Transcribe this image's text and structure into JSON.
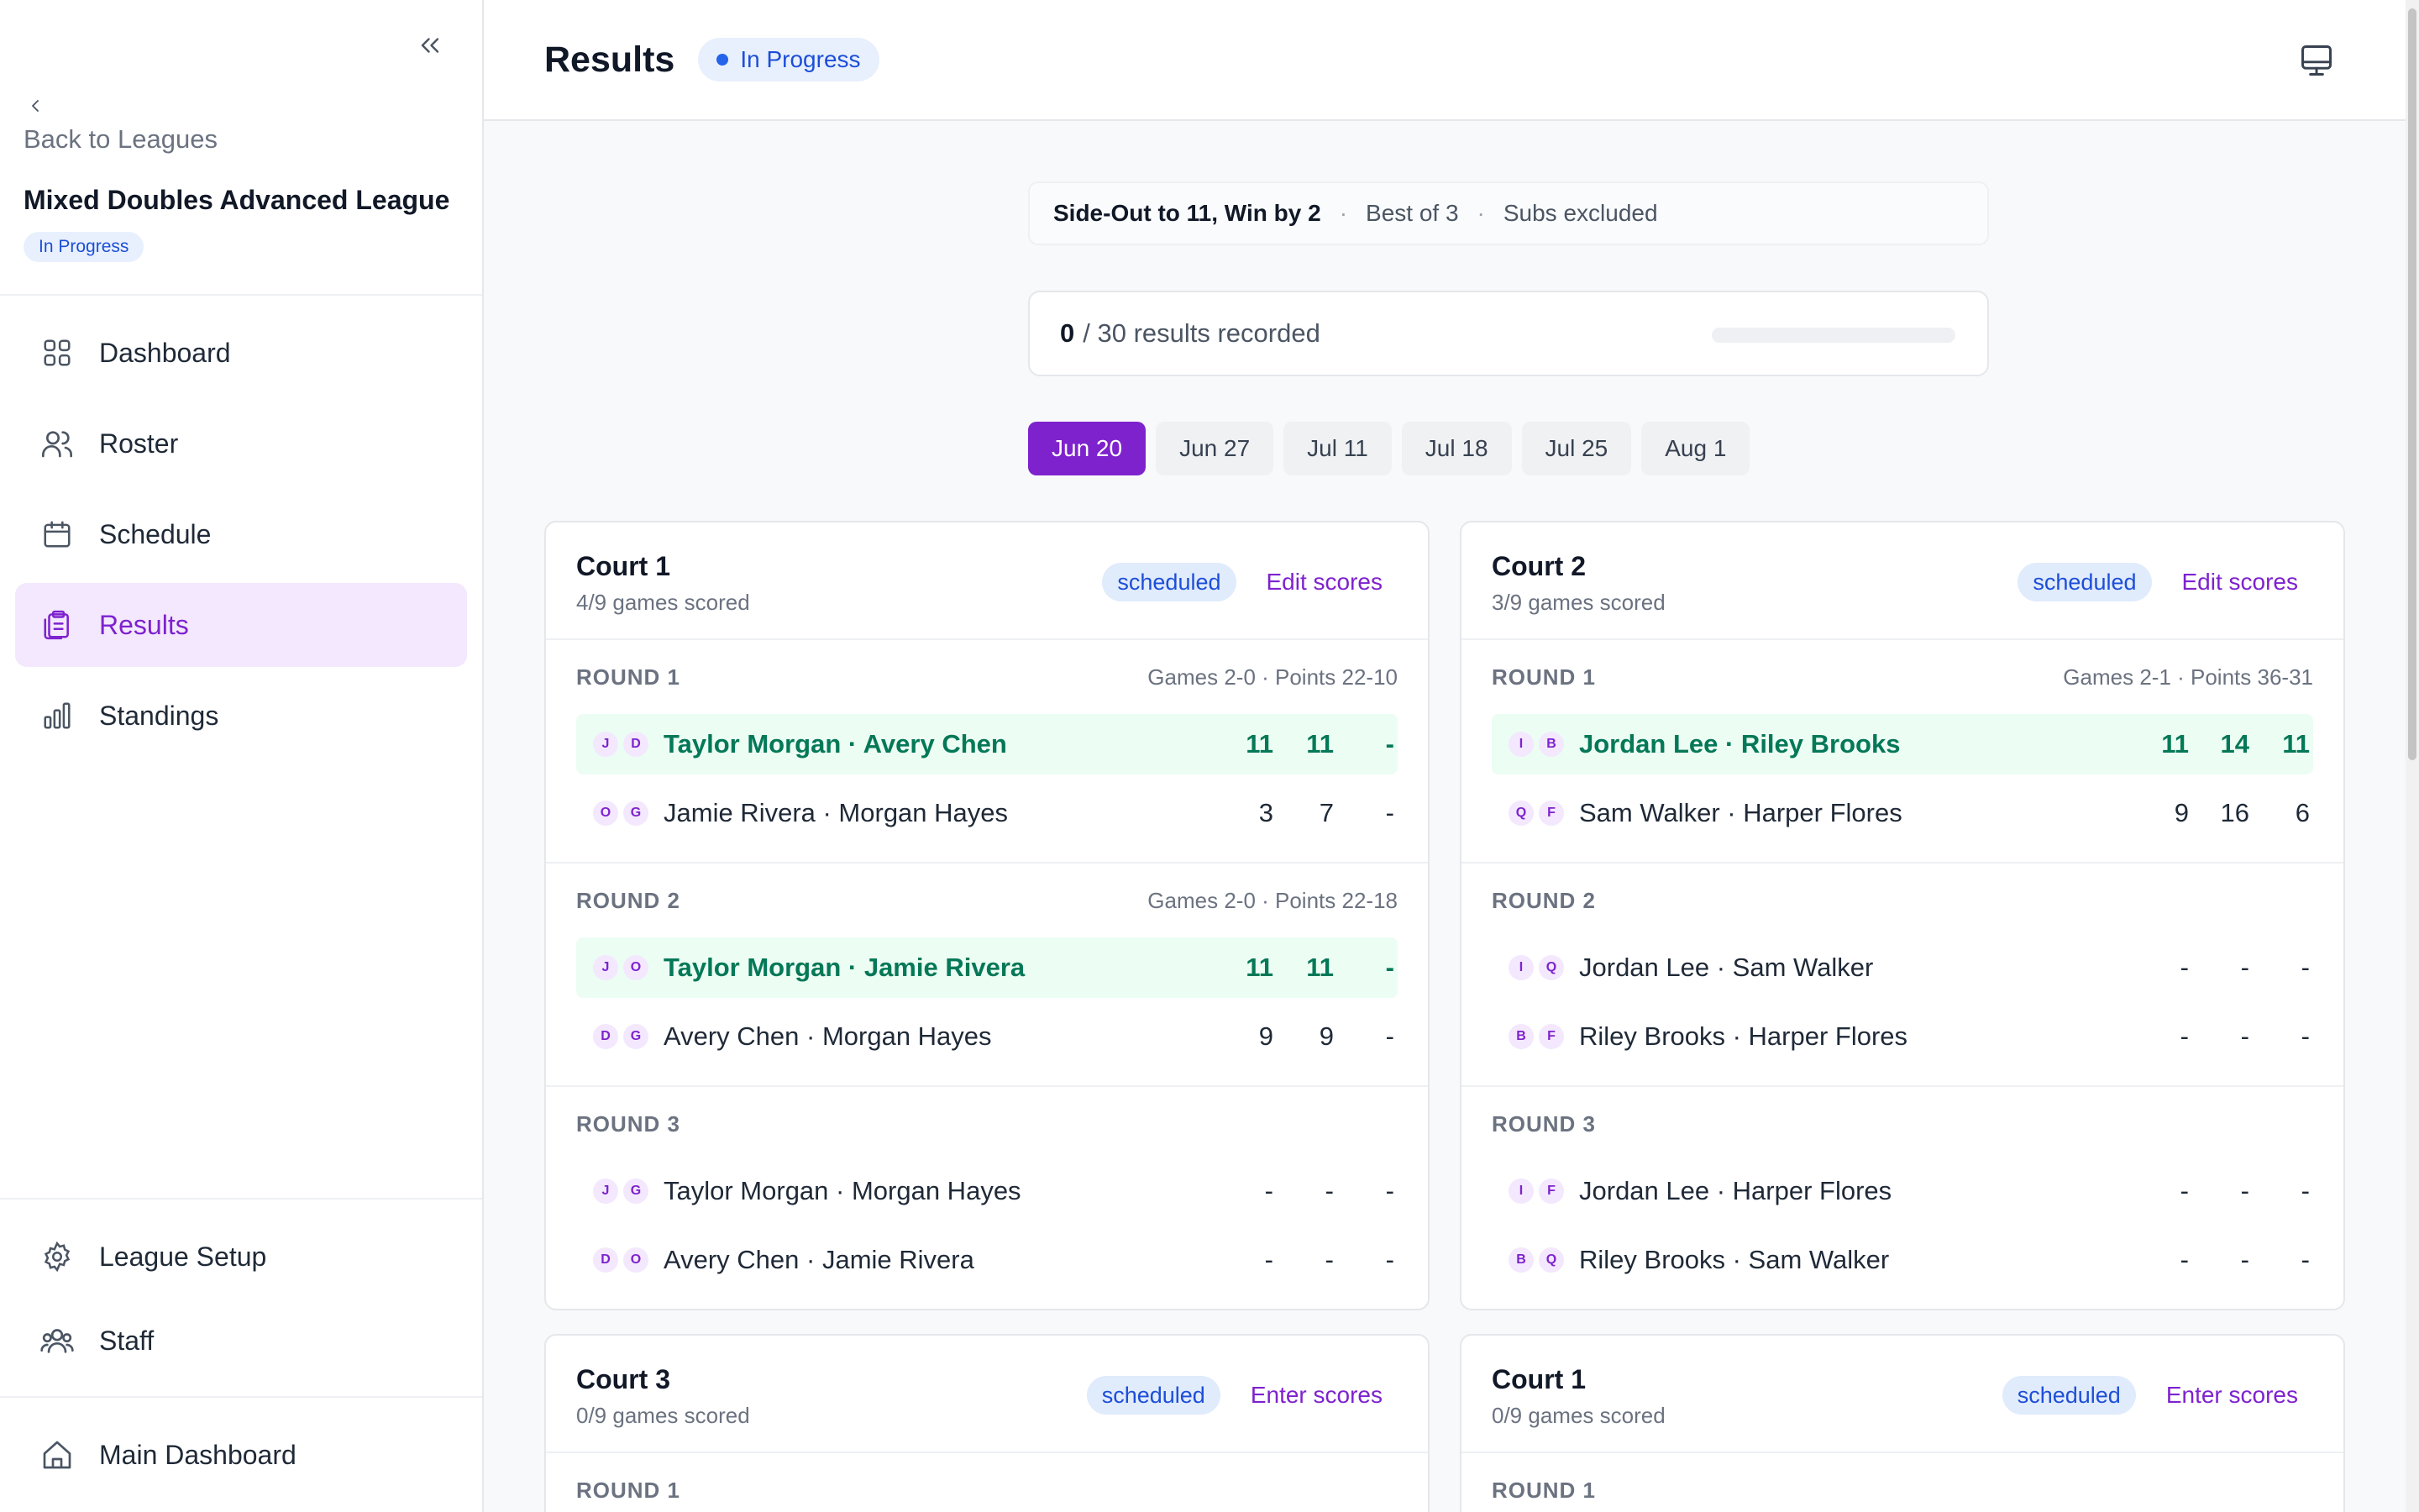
{
  "sidebar": {
    "back_label": "Back to Leagues",
    "league_name": "Mixed Doubles Advanced League",
    "league_status": "In Progress",
    "nav": [
      {
        "label": "Dashboard",
        "icon": "grid-icon"
      },
      {
        "label": "Roster",
        "icon": "users-icon"
      },
      {
        "label": "Schedule",
        "icon": "calendar-icon"
      },
      {
        "label": "Results",
        "icon": "clipboard-icon",
        "active": true
      },
      {
        "label": "Standings",
        "icon": "bar-chart-icon"
      }
    ],
    "bottom_nav": [
      {
        "label": "League Setup",
        "icon": "gear-icon"
      },
      {
        "label": "Staff",
        "icon": "staff-icon"
      }
    ],
    "footer_nav": {
      "label": "Main Dashboard",
      "icon": "home-icon"
    }
  },
  "header": {
    "title": "Results",
    "status": "In Progress"
  },
  "format": {
    "rule": "Side-Out to 11, Win by 2",
    "sep": "·",
    "series": "Best of 3",
    "subs": "Subs excluded"
  },
  "progress": {
    "recorded": "0",
    "total_text": "/ 30 results recorded",
    "fraction": 0
  },
  "date_tabs": [
    "Jun 20",
    "Jun 27",
    "Jul 11",
    "Jul 18",
    "Jul 25",
    "Aug 1"
  ],
  "active_date": "Jun 20",
  "courts": [
    {
      "title": "Court 1",
      "scored": "4/9 games scored",
      "badge": "scheduled",
      "action": "Edit scores",
      "rounds": [
        {
          "label": "ROUND 1",
          "meta": "Games 2-0 · Points 22-10",
          "teams": [
            {
              "avatars": [
                "J",
                "D"
              ],
              "name": "Taylor Morgan · Avery Chen",
              "scores": [
                "11",
                "11",
                "-"
              ],
              "winner": true
            },
            {
              "avatars": [
                "O",
                "G"
              ],
              "name": "Jamie Rivera · Morgan Hayes",
              "scores": [
                "3",
                "7",
                "-"
              ],
              "winner": false
            }
          ]
        },
        {
          "label": "ROUND 2",
          "meta": "Games 2-0 · Points 22-18",
          "teams": [
            {
              "avatars": [
                "J",
                "O"
              ],
              "name": "Taylor Morgan · Jamie Rivera",
              "scores": [
                "11",
                "11",
                "-"
              ],
              "winner": true
            },
            {
              "avatars": [
                "D",
                "G"
              ],
              "name": "Avery Chen · Morgan Hayes",
              "scores": [
                "9",
                "9",
                "-"
              ],
              "winner": false
            }
          ]
        },
        {
          "label": "ROUND 3",
          "meta": "",
          "teams": [
            {
              "avatars": [
                "J",
                "G"
              ],
              "name": "Taylor Morgan · Morgan Hayes",
              "scores": [
                "-",
                "-",
                "-"
              ],
              "winner": false
            },
            {
              "avatars": [
                "D",
                "O"
              ],
              "name": "Avery Chen · Jamie Rivera",
              "scores": [
                "-",
                "-",
                "-"
              ],
              "winner": false
            }
          ]
        }
      ]
    },
    {
      "title": "Court 2",
      "scored": "3/9 games scored",
      "badge": "scheduled",
      "action": "Edit scores",
      "rounds": [
        {
          "label": "ROUND 1",
          "meta": "Games 2-1 · Points 36-31",
          "teams": [
            {
              "avatars": [
                "I",
                "B"
              ],
              "name": "Jordan Lee · Riley Brooks",
              "scores": [
                "11",
                "14",
                "11"
              ],
              "winner": true
            },
            {
              "avatars": [
                "Q",
                "F"
              ],
              "name": "Sam Walker · Harper Flores",
              "scores": [
                "9",
                "16",
                "6"
              ],
              "winner": false
            }
          ]
        },
        {
          "label": "ROUND 2",
          "meta": "",
          "teams": [
            {
              "avatars": [
                "I",
                "Q"
              ],
              "name": "Jordan Lee · Sam Walker",
              "scores": [
                "-",
                "-",
                "-"
              ],
              "winner": false
            },
            {
              "avatars": [
                "B",
                "F"
              ],
              "name": "Riley Brooks · Harper Flores",
              "scores": [
                "-",
                "-",
                "-"
              ],
              "winner": false
            }
          ]
        },
        {
          "label": "ROUND 3",
          "meta": "",
          "teams": [
            {
              "avatars": [
                "I",
                "F"
              ],
              "name": "Jordan Lee · Harper Flores",
              "scores": [
                "-",
                "-",
                "-"
              ],
              "winner": false
            },
            {
              "avatars": [
                "B",
                "Q"
              ],
              "name": "Riley Brooks · Sam Walker",
              "scores": [
                "-",
                "-",
                "-"
              ],
              "winner": false
            }
          ]
        }
      ]
    },
    {
      "title": "Court 3",
      "scored": "0/9 games scored",
      "badge": "scheduled",
      "action": "Enter scores",
      "rounds": [
        {
          "label": "ROUND 1",
          "meta": "",
          "teams": []
        }
      ]
    },
    {
      "title": "Court 1",
      "scored": "0/9 games scored",
      "badge": "scheduled",
      "action": "Enter scores",
      "rounds": [
        {
          "label": "ROUND 1",
          "meta": "",
          "teams": []
        }
      ]
    }
  ],
  "colors": {
    "accent": "#7e22ce",
    "win_bg": "#ecfdf3",
    "win_text": "#047857",
    "badge_bg": "#e0ebfc",
    "badge_text": "#1d4ed8"
  }
}
